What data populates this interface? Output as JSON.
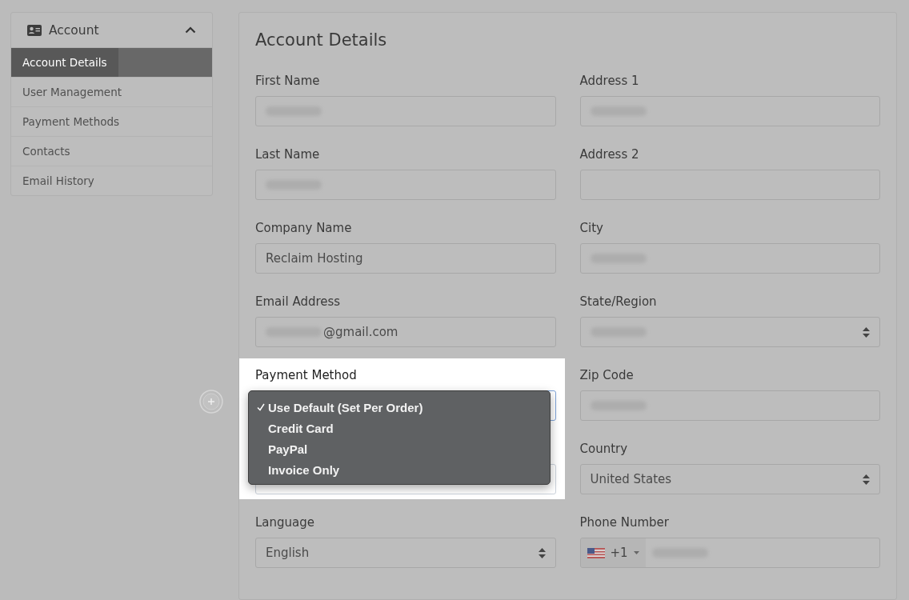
{
  "sidebar": {
    "title": "Account",
    "expanded": true,
    "items": [
      {
        "label": "Account Details",
        "selected": true
      },
      {
        "label": "User Management",
        "selected": false
      },
      {
        "label": "Payment Methods",
        "selected": false
      },
      {
        "label": "Contacts",
        "selected": false
      },
      {
        "label": "Email History",
        "selected": false
      }
    ]
  },
  "form": {
    "title": "Account Details",
    "left_fields": [
      {
        "kind": "text",
        "label": "First Name",
        "redacted": true
      },
      {
        "kind": "text",
        "label": "Last Name",
        "redacted": true
      },
      {
        "kind": "text",
        "label": "Company Name",
        "value": "Reclaim Hosting"
      },
      {
        "kind": "text",
        "label": "Email Address",
        "redacted": true,
        "value": "@gmail.com"
      },
      {
        "kind": "select",
        "label": "Payment Method",
        "highlighted": true,
        "focused": true,
        "menu": [
          {
            "label": "Use Default (Set Per Order)",
            "selected": true
          },
          {
            "label": "Credit Card",
            "selected": false
          },
          {
            "label": "PayPal",
            "selected": false
          },
          {
            "label": "Invoice Only",
            "selected": false
          }
        ]
      },
      {
        "kind": "text",
        "highlighted": true
      },
      {
        "kind": "select",
        "label": "Language",
        "value": "English"
      }
    ],
    "right_fields": [
      {
        "kind": "text",
        "label": "Address 1",
        "redacted": true
      },
      {
        "kind": "text",
        "label": "Address 2"
      },
      {
        "kind": "text",
        "label": "City",
        "redacted": true
      },
      {
        "kind": "select",
        "label": "State/Region",
        "redacted": true
      },
      {
        "kind": "text",
        "label": "Zip Code",
        "redacted": true
      },
      {
        "kind": "select",
        "label": "Country",
        "value": "United States"
      },
      {
        "kind": "phone",
        "label": "Phone Number",
        "dial_code": "+1",
        "redacted": true
      }
    ]
  }
}
